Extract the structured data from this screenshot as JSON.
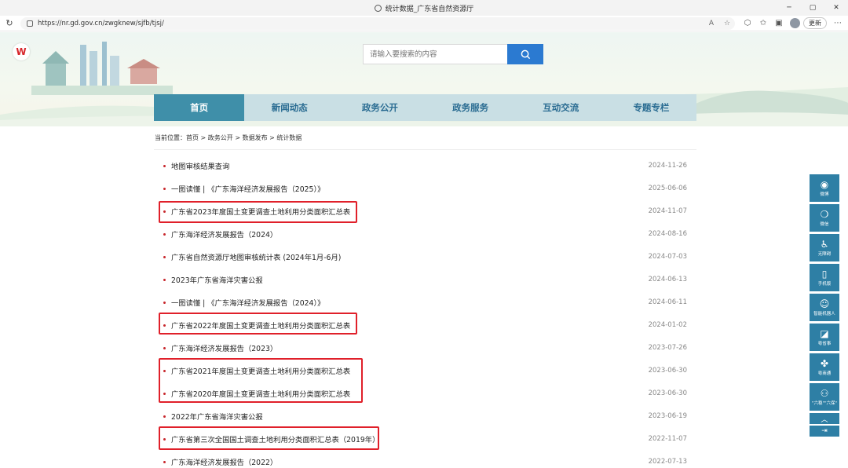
{
  "browser": {
    "tab_title": "统计数据_广东省自然资源厅",
    "url": "https://nr.gd.gov.cn/zwgknew/sjfb/tjsj/",
    "update_button": "更新"
  },
  "search": {
    "placeholder": "请输入要搜索的内容"
  },
  "nav": {
    "items": [
      "首页",
      "新闻动态",
      "政务公开",
      "政务服务",
      "互动交流",
      "专题专栏"
    ]
  },
  "breadcrumb": {
    "text": "当前位置：首页 > 政务公开 > 数据发布 > 统计数据"
  },
  "list": {
    "items": [
      {
        "title": "地图审核结果查询",
        "date": "2024-11-26"
      },
      {
        "title": "一图读懂 | 《广东海洋经济发展报告（2025）》",
        "date": "2025-06-06"
      },
      {
        "title": "广东省2023年度国土变更调查土地利用分类面积汇总表",
        "date": "2024-11-07"
      },
      {
        "title": "广东海洋经济发展报告（2024）",
        "date": "2024-08-16"
      },
      {
        "title": "广东省自然资源厅地图审核统计表 (2024年1月-6月)",
        "date": "2024-07-03"
      },
      {
        "title": "2023年广东省海洋灾害公报",
        "date": "2024-06-13"
      },
      {
        "title": "一图读懂 | 《广东海洋经济发展报告（2024）》",
        "date": "2024-06-11"
      },
      {
        "title": "广东省2022年度国土变更调查土地利用分类面积汇总表",
        "date": "2024-01-02"
      },
      {
        "title": "广东海洋经济发展报告（2023）",
        "date": "2023-07-26"
      },
      {
        "title": "广东省2021年度国土变更调查土地利用分类面积汇总表",
        "date": "2023-06-30"
      },
      {
        "title": "广东省2020年度国土变更调查土地利用分类面积汇总表",
        "date": "2023-06-30"
      },
      {
        "title": "2022年广东省海洋灾害公报",
        "date": "2023-06-19"
      },
      {
        "title": "广东省第三次全国国土调查土地利用分类面积汇总表（2019年）",
        "date": "2022-11-07"
      },
      {
        "title": "广东海洋经济发展报告（2022）",
        "date": "2022-07-13"
      }
    ]
  },
  "sidebar": {
    "items": [
      "微博",
      "微信",
      "无障碍",
      "手机版",
      "智能机器人",
      "粤省事",
      "粤商通",
      "\"六稳\"\"六保\""
    ]
  },
  "colors": {
    "nav_bg": "#c9dfe4",
    "nav_active": "#3f8fa9",
    "highlight": "#e0202a",
    "bullet": "#c8282d",
    "sidebar": "#2e7fa5"
  }
}
